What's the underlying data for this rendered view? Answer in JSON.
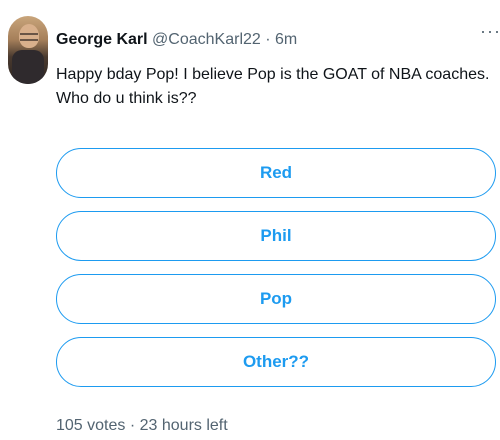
{
  "tweet": {
    "author_name": "George Karl",
    "handle": "@CoachKarl22",
    "separator": "·",
    "time_ago": "6m",
    "more_label": "···",
    "text": "Happy bday Pop! I believe Pop is the GOAT of NBA coaches. Who do u think is??"
  },
  "poll": {
    "options": [
      {
        "label": "Red"
      },
      {
        "label": "Phil"
      },
      {
        "label": "Pop"
      },
      {
        "label": "Other??"
      }
    ],
    "votes": "105 votes",
    "separator": "·",
    "time_left": "23 hours left"
  },
  "colors": {
    "accent": "#1d9bf0",
    "text": "#0f1419",
    "secondary_text": "#536471"
  },
  "icons": {
    "more": "more-horizontal-icon"
  }
}
